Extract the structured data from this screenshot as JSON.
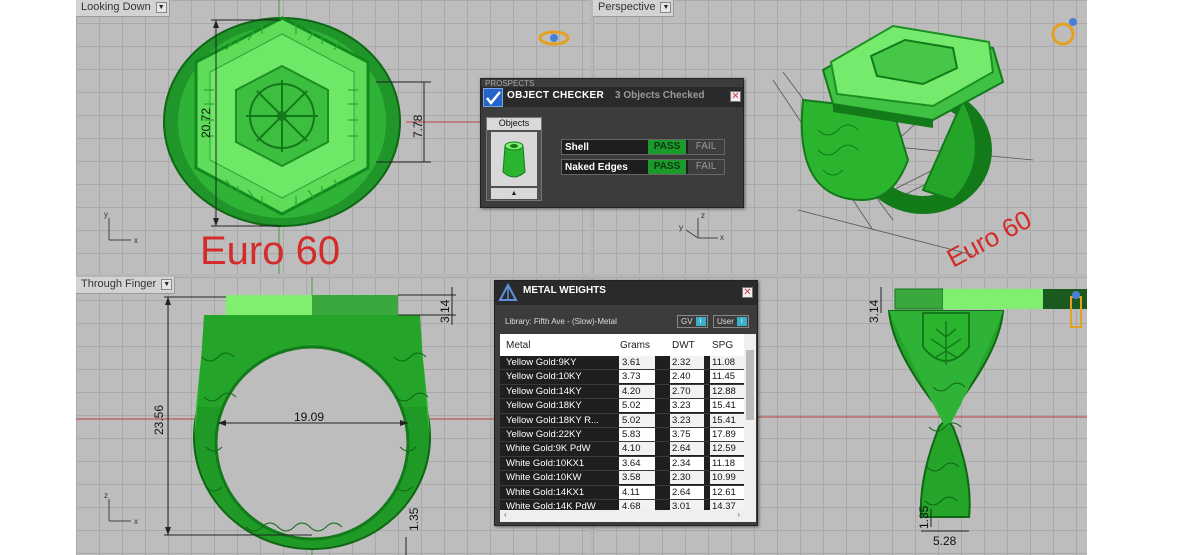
{
  "viewports": {
    "top_left": {
      "title": "Looking Down",
      "dim_height": "20.72",
      "dim_width": "7.78",
      "caption": "Euro 60"
    },
    "top_right": {
      "title": "Perspective",
      "caption": "Euro 60"
    },
    "bottom_left": {
      "title": "Through Finger",
      "dim_top": "3.14",
      "dim_height": "23.56",
      "dim_inner": "19.09",
      "dim_bottom": "1.35"
    },
    "bottom_right": {
      "dim_top": "3.14",
      "dim_bottom": "1.35",
      "dim_width": "5.28"
    }
  },
  "object_checker": {
    "tab_label": "PROSPECTS",
    "title": "OBJECT CHECKER",
    "count": "3  Objects Checked",
    "objects_label": "Objects",
    "rows": [
      {
        "label": "Shell",
        "pass": "PASS",
        "fail": "FAIL"
      },
      {
        "label": "Naked Edges",
        "pass": "PASS",
        "fail": "FAIL"
      }
    ]
  },
  "metal_weights": {
    "title": "METAL WEIGHTS",
    "library": "Library: Fifth Ave - (Slow)-Metal",
    "gv_label": "GV",
    "user_label": "User",
    "columns": [
      "Metal",
      "Grams",
      "DWT",
      "SPG"
    ],
    "rows": [
      [
        "Yellow Gold:9KY",
        "3.61",
        "2.32",
        "11.08"
      ],
      [
        "Yellow Gold:10KY",
        "3.73",
        "2.40",
        "11.45"
      ],
      [
        "Yellow Gold:14KY",
        "4.20",
        "2.70",
        "12.88"
      ],
      [
        "Yellow Gold:18KY",
        "5.02",
        "3.23",
        "15.41"
      ],
      [
        "Yellow Gold:18KY R...",
        "5.02",
        "3.23",
        "15.41"
      ],
      [
        "Yellow Gold:22KY",
        "5.83",
        "3.75",
        "17.89"
      ],
      [
        "White Gold:9K PdW",
        "4.10",
        "2.64",
        "12.59"
      ],
      [
        "White Gold:10KX1",
        "3.64",
        "2.34",
        "11.18"
      ],
      [
        "White Gold:10KW",
        "3.58",
        "2.30",
        "10.99"
      ],
      [
        "White Gold:14KX1",
        "4.11",
        "2.64",
        "12.61"
      ],
      [
        "White Gold:14K PdW",
        "4.68",
        "3.01",
        "14.37"
      ]
    ]
  },
  "colors": {
    "ring_green": "#2bb52f",
    "ring_dark": "#137a1a",
    "highlight": "#7ef06a",
    "caption_red": "#d42a2a"
  }
}
